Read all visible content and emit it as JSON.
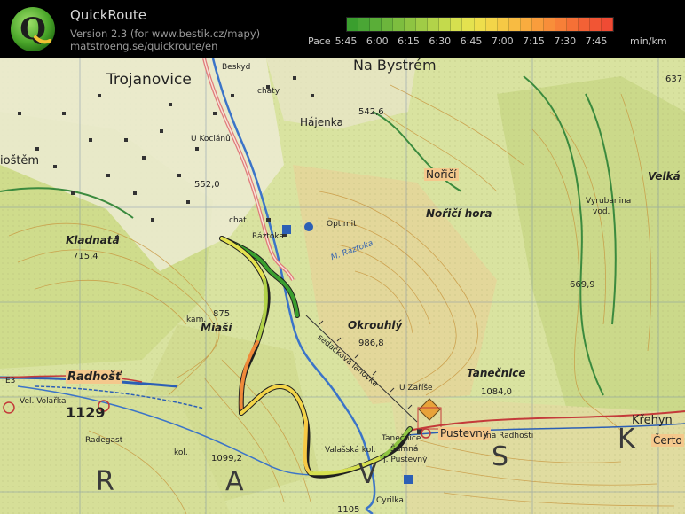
{
  "app": {
    "title": "QuickRoute",
    "version_line": "Version 2.3  (for www.bestik.cz/mapy)",
    "url_line": "matstroeng.se/quickroute/en",
    "logo_letter": "Q"
  },
  "pace_scale": {
    "prefix": "Pace",
    "ticks": [
      "5:45",
      "6:00",
      "6:15",
      "6:30",
      "6:45",
      "7:00",
      "7:15",
      "7:30",
      "7:45"
    ],
    "unit": "min/km",
    "colors": [
      "#3a9e2e",
      "#4aa635",
      "#5aae38",
      "#6cb53c",
      "#7dbd3f",
      "#8ec442",
      "#a0cc46",
      "#b2d349",
      "#c4da4c",
      "#d6e04f",
      "#e4e24f",
      "#eede4c",
      "#f3d549",
      "#f6c945",
      "#f8bb42",
      "#f9ac3f",
      "#f99d3c",
      "#f88e3a",
      "#f77f38",
      "#f57036",
      "#f36135",
      "#f15534",
      "#ef4b34"
    ]
  },
  "map": {
    "labels": [
      {
        "text": "Na Bystrém",
        "style": "big"
      },
      {
        "text": "Trojanovice",
        "style": "big"
      },
      {
        "text": "Beskyd",
        "style": "sm"
      },
      {
        "text": "chaty",
        "style": "sm"
      },
      {
        "text": "542,6",
        "style": "num"
      },
      {
        "text": "Hájenka",
        "style": "plain"
      },
      {
        "text": "U Kociánů",
        "style": "sm"
      },
      {
        "text": "ioštěm",
        "style": "plain"
      },
      {
        "text": "552,0",
        "style": "num"
      },
      {
        "text": "Nořičí",
        "style": "box"
      },
      {
        "text": "Nořičí hora",
        "style": "it"
      },
      {
        "text": "Velká",
        "style": "it"
      },
      {
        "text": "Vyrubanina",
        "style": "sm"
      },
      {
        "text": "vod.",
        "style": "sm"
      },
      {
        "text": "637",
        "style": "num"
      },
      {
        "text": "Kladnatá",
        "style": "it"
      },
      {
        "text": "715,4",
        "style": "num"
      },
      {
        "text": "chat.",
        "style": "sm"
      },
      {
        "text": "Ráztoka",
        "style": "sm"
      },
      {
        "text": "Optimit",
        "style": "sm"
      },
      {
        "text": "M. Ráztoka",
        "style": "blue"
      },
      {
        "text": "669,9",
        "style": "num"
      },
      {
        "text": "875",
        "style": "num"
      },
      {
        "text": "kam.",
        "style": "sm"
      },
      {
        "text": "Miaší",
        "style": "it"
      },
      {
        "text": "Okrouhlý",
        "style": "it"
      },
      {
        "text": "986,8",
        "style": "num"
      },
      {
        "text": "sedačková lanovka",
        "style": "sm"
      },
      {
        "text": "Tanečnice",
        "style": "it"
      },
      {
        "text": "1084,0",
        "style": "num"
      },
      {
        "text": "U Zaříše",
        "style": "sm"
      },
      {
        "text": "Radhošť",
        "style": "box"
      },
      {
        "text": "Vel. Volařka",
        "style": "sm"
      },
      {
        "text": "1129",
        "style": "big"
      },
      {
        "text": "Radegast",
        "style": "sm"
      },
      {
        "text": "kol.",
        "style": "sm"
      },
      {
        "text": "1099,2",
        "style": "num"
      },
      {
        "text": "Valašská kol.",
        "style": "sm"
      },
      {
        "text": "Tanečnice",
        "style": "sm"
      },
      {
        "text": "Šumná",
        "style": "sm"
      },
      {
        "text": "J. Pustevný",
        "style": "sm"
      },
      {
        "text": "Pustevny",
        "style": "box"
      },
      {
        "text": "na Radhošti",
        "style": "sm"
      },
      {
        "text": "Křehyn",
        "style": "plain"
      },
      {
        "text": "Čerto",
        "style": "box"
      },
      {
        "text": "E3",
        "style": "sm"
      },
      {
        "text": "Cyrilka",
        "style": "sm"
      },
      {
        "text": "1105",
        "style": "num"
      },
      {
        "text": "R",
        "style": "huge"
      },
      {
        "text": "A",
        "style": "huge"
      },
      {
        "text": "V",
        "style": "huge"
      },
      {
        "text": "S",
        "style": "huge"
      },
      {
        "text": "K",
        "style": "huge"
      }
    ]
  }
}
